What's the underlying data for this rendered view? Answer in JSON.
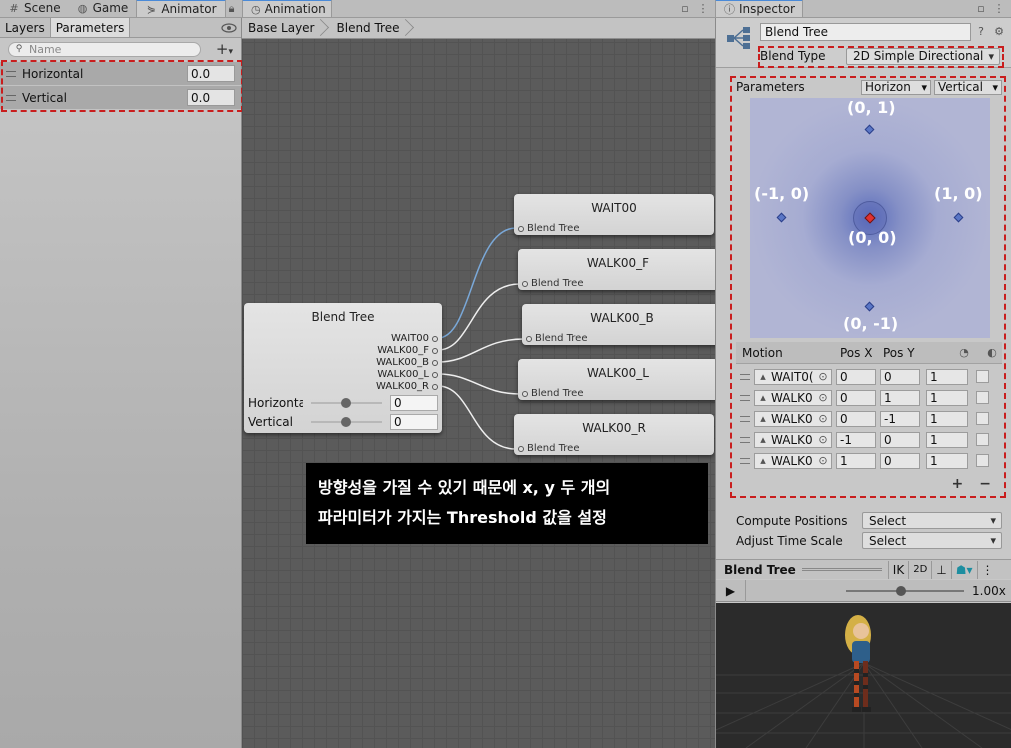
{
  "left_tabs": [
    {
      "label": "Scene",
      "icon": "grid-icon"
    },
    {
      "label": "Game",
      "icon": "gamepad-icon"
    },
    {
      "label": "Animator",
      "icon": "animator-icon"
    }
  ],
  "left_panel": {
    "subtabs": [
      "Layers",
      "Parameters"
    ],
    "search_placeholder": "Name",
    "parameters": [
      {
        "name": "Horizontal",
        "value": "0.0"
      },
      {
        "name": "Vertical",
        "value": "0.0"
      }
    ]
  },
  "center_tab": {
    "label": "Animation"
  },
  "graph": {
    "breadcrumb": [
      "Base Layer",
      "Blend Tree"
    ],
    "blend_tree_node": {
      "title": "Blend Tree",
      "outputs": [
        "WAIT00",
        "WALK00_F",
        "WALK00_B",
        "WALK00_L",
        "WALK00_R"
      ],
      "inputs": [
        {
          "label": "Horizonta",
          "value": "0"
        },
        {
          "label": "Vertical",
          "value": "0"
        }
      ]
    },
    "motion_nodes": [
      {
        "title": "WAIT00",
        "sub": "Blend Tree"
      },
      {
        "title": "WALK00_F",
        "sub": "Blend Tree"
      },
      {
        "title": "WALK00_B",
        "sub": "Blend Tree"
      },
      {
        "title": "WALK00_L",
        "sub": "Blend Tree"
      },
      {
        "title": "WALK00_R",
        "sub": "Blend Tree"
      }
    ],
    "caption_line1": "방향성을 가질 수 있기 때문에 x, y 두 개의",
    "caption_line2": "파라미터가 가지는 Threshold 값을 설정"
  },
  "inspector": {
    "tab_label": "Inspector",
    "name": "Blend Tree",
    "blend_type_label": "Blend Type",
    "blend_type_value": "2D Simple Directional",
    "parameters_label": "Parameters",
    "param_x": "Horizon",
    "param_y": "Vertical",
    "points": [
      {
        "label": "(0, 1)"
      },
      {
        "label": "(-1, 0)"
      },
      {
        "label": "(1, 0)"
      },
      {
        "label": "(0, 0)"
      },
      {
        "label": "(0, -1)"
      }
    ],
    "motion_header": {
      "motion": "Motion",
      "pos_x": "Pos X",
      "pos_y": "Pos Y"
    },
    "motions": [
      {
        "clip": "WAIT0(",
        "pos_x": "0",
        "pos_y": "0",
        "speed": "1"
      },
      {
        "clip": "WALK0",
        "pos_x": "0",
        "pos_y": "1",
        "speed": "1"
      },
      {
        "clip": "WALK0",
        "pos_x": "0",
        "pos_y": "-1",
        "speed": "1"
      },
      {
        "clip": "WALK0",
        "pos_x": "-1",
        "pos_y": "0",
        "speed": "1"
      },
      {
        "clip": "WALK0",
        "pos_x": "1",
        "pos_y": "0",
        "speed": "1"
      }
    ],
    "plus_label": "+",
    "minus_label": "−",
    "compute_positions_label": "Compute Positions",
    "compute_positions_value": "Select",
    "adjust_time_scale_label": "Adjust Time Scale",
    "adjust_time_scale_value": "Select",
    "preview_title": "Blend Tree",
    "preview_buttons": [
      "IK",
      "2D"
    ],
    "speed": "1.00x"
  },
  "colors": {
    "highlight": "#c91d1d",
    "accent": "#4a8ad8",
    "graph_bg": "#5b5b5b"
  }
}
